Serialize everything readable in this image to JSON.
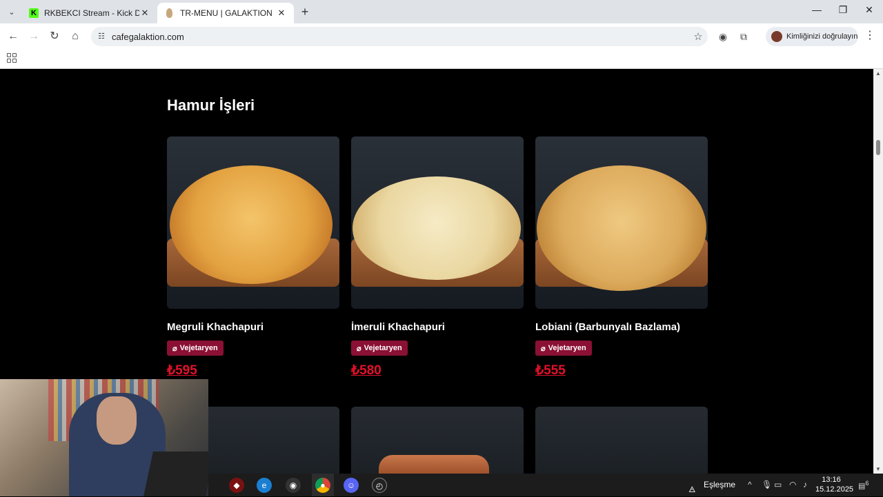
{
  "tabs": [
    {
      "title": "RKBEKCI Stream - Kick Dashboa",
      "favicon": "kick-logo-icon",
      "favicon_text": "K",
      "active": false
    },
    {
      "title": "TR-MENU | GALAKTION",
      "favicon": "galaktion-logo-icon",
      "active": true
    }
  ],
  "toolbar": {
    "url": "cafegalaktion.com",
    "profile_label": "Kimliğinizi doğrulayın"
  },
  "page": {
    "section_title": "Hamur İşleri",
    "products": [
      {
        "name": "Megruli Khachapuri",
        "badge": "Vejetaryen",
        "price": "₺595"
      },
      {
        "name": "İmeruli Khachapuri",
        "badge": "Vejetaryen",
        "price": "₺580"
      },
      {
        "name": "Lobiani (Barbunyalı Bazlama)",
        "badge": "Vejetaryen",
        "price": "₺555"
      }
    ]
  },
  "taskbar": {
    "notification_text": "Eşleşme",
    "time": "13:16",
    "date": "15.12.2025",
    "notification_count": "6"
  },
  "colors": {
    "accent_badge": "#8a1034",
    "price_red": "#e3102b",
    "page_bg": "#000000"
  }
}
